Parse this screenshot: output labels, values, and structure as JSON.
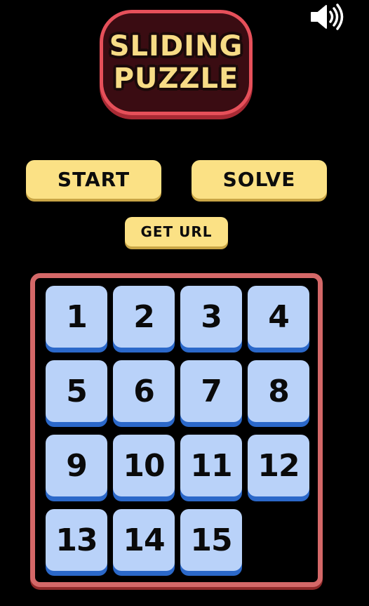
{
  "title": {
    "line1": "SLIDING",
    "line2": "PUZZLE"
  },
  "icons": {
    "sound": "speaker-volume-icon"
  },
  "buttons": {
    "start": "START",
    "solve": "SOLVE",
    "get_url": "GET URL"
  },
  "board": {
    "size": 4,
    "tiles": [
      "1",
      "2",
      "3",
      "4",
      "5",
      "6",
      "7",
      "8",
      "9",
      "10",
      "11",
      "12",
      "13",
      "14",
      "15",
      ""
    ]
  },
  "colors": {
    "background": "#000000",
    "button": "#fbe185",
    "tile": "#b9d2f9",
    "tile_shadow": "#2b68c9",
    "board_border": "#d46868",
    "logo_border": "#e6505a",
    "logo_text": "#f7dc86"
  }
}
